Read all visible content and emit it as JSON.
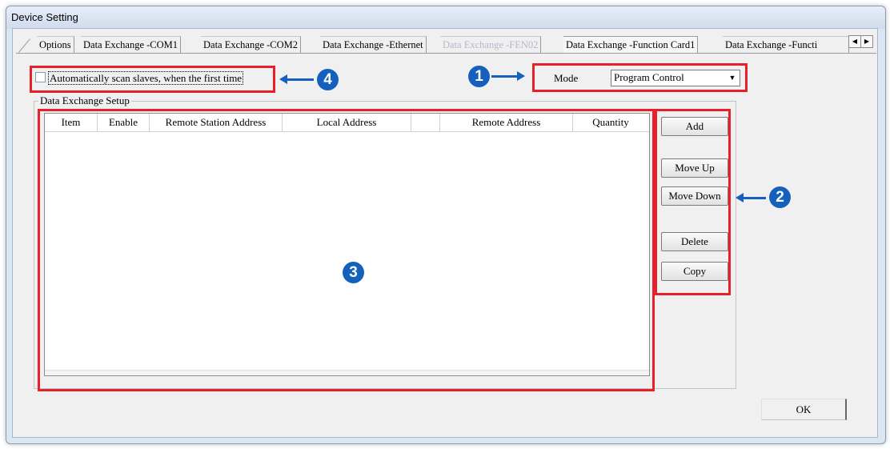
{
  "window": {
    "title": "Device Setting"
  },
  "tabs": [
    {
      "label": "Options"
    },
    {
      "label": "Data Exchange -COM1"
    },
    {
      "label": "Data Exchange -COM2"
    },
    {
      "label": "Data Exchange -Ethernet"
    },
    {
      "label": "Data Exchange -FEN02"
    },
    {
      "label": "Data Exchange -Function Card1"
    },
    {
      "label": "Data Exchange -Functi"
    }
  ],
  "tab_scroll": {
    "left": "◀",
    "right": "▶"
  },
  "auto_scan": {
    "label": "Automatically scan slaves, when the first time",
    "checked": false
  },
  "mode": {
    "label": "Mode",
    "value": "Program Control"
  },
  "group": {
    "title": "Data Exchange Setup"
  },
  "table": {
    "columns": [
      "Item",
      "Enable",
      "Remote Station Address",
      "Local Address",
      "",
      "Remote Address",
      "Quantity"
    ],
    "rows": []
  },
  "buttons": {
    "add": "Add",
    "move_up": "Move Up",
    "move_down": "Move Down",
    "delete": "Delete",
    "copy": "Copy",
    "ok": "OK"
  },
  "annotations": {
    "n1": "1",
    "n2": "2",
    "n3": "3",
    "n4": "4",
    "color": "#1560bd",
    "box_color": "#e8202a"
  }
}
